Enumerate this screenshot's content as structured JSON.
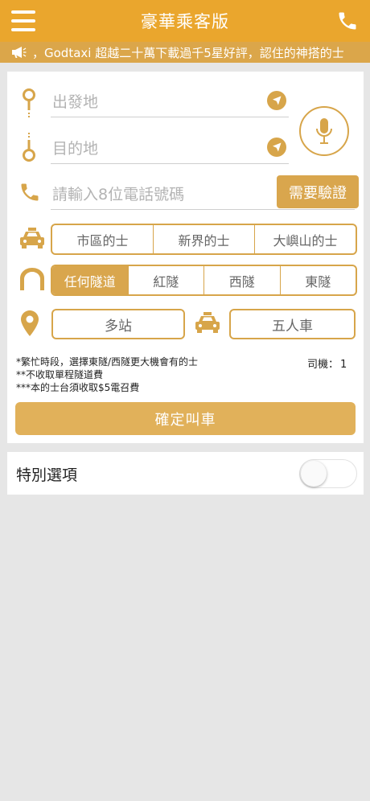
{
  "header": {
    "title": "豪華乘客版",
    "menu_icon": "hamburger-menu-icon",
    "phone_icon": "phone-icon"
  },
  "announcement": {
    "icon": "megaphone-icon",
    "text": "，Godtaxi 超越二十萬下載過千5星好評，認住的神搭的士"
  },
  "booking": {
    "pickup_placeholder": "出發地",
    "destination_placeholder": "目的地",
    "phone_placeholder": "請輸入8位電話號碼",
    "verify_label": "需要驗證",
    "taxi_types": [
      {
        "label": "市區的士",
        "active": false
      },
      {
        "label": "新界的士",
        "active": false
      },
      {
        "label": "大嶼山的士",
        "active": false
      }
    ],
    "tunnels": [
      {
        "label": "任何隧道",
        "active": true
      },
      {
        "label": "紅隧",
        "active": false
      },
      {
        "label": "西隧",
        "active": false
      },
      {
        "label": "東隧",
        "active": false
      }
    ],
    "multi_stop_label": "多站",
    "five_seater_label": "五人車",
    "notes": [
      "*繁忙時段，選擇東隧/西隧更大機會有的士",
      "**不收取單程隧道費",
      "***本的士台須收取$5電召費"
    ],
    "driver_label": "司機：",
    "driver_count": "1",
    "confirm_label": "確定叫車"
  },
  "special": {
    "label": "特別選項",
    "toggle_on": false
  },
  "colors": {
    "header": "#eaa62d",
    "marquee": "#dba64a",
    "accent": "#d7a54a",
    "confirm": "#e1b15a"
  }
}
